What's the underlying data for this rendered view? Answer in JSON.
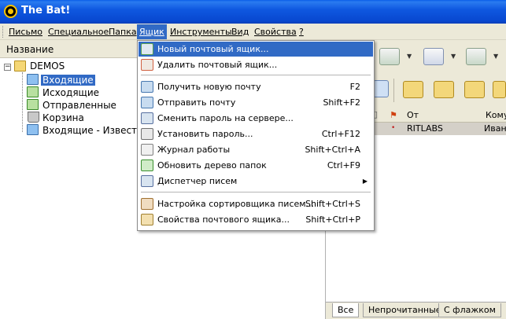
{
  "window": {
    "title": "The Bat!"
  },
  "menubar": {
    "items": [
      {
        "label": "Письмо"
      },
      {
        "label": "Специальное"
      },
      {
        "label": "Папка"
      },
      {
        "label": "Ящик"
      },
      {
        "label": "Инструменты"
      },
      {
        "label": "Вид"
      },
      {
        "label": "Свойства"
      },
      {
        "label": "?"
      }
    ]
  },
  "tree": {
    "header": "Название",
    "root": "DEMOS",
    "folders": [
      {
        "label": "Входящие",
        "icon": "inbox-folder-icon",
        "selected": true
      },
      {
        "label": "Исходящие",
        "icon": "outbox-folder-icon"
      },
      {
        "label": "Отправленные",
        "icon": "sent-folder-icon"
      },
      {
        "label": "Корзина",
        "icon": "trash-icon"
      },
      {
        "label": "Входящие - Известные",
        "icon": "inbox-known-folder-icon"
      }
    ]
  },
  "message_list": {
    "columns": [
      "От",
      "Кому"
    ],
    "rows": [
      {
        "from": "RITLABS",
        "to": "Иван"
      }
    ]
  },
  "tabs": [
    "Все",
    "Непрочитанные",
    "С флажком"
  ],
  "dropdown": {
    "items": [
      {
        "label": "Новый почтовый ящик...",
        "shortcut": "",
        "icon": "new-mailbox-icon",
        "highlight": true
      },
      {
        "label": "Удалить почтовый ящик...",
        "shortcut": "",
        "icon": "delete-mailbox-icon"
      },
      {
        "label": "Получить новую почту",
        "shortcut": "F2",
        "icon": "get-mail-icon"
      },
      {
        "label": "Отправить почту",
        "shortcut": "Shift+F2",
        "icon": "send-mail-icon"
      },
      {
        "label": "Сменить пароль на сервере...",
        "shortcut": "",
        "icon": "change-password-icon"
      },
      {
        "label": "Установить пароль...",
        "shortcut": "Ctrl+F12",
        "icon": "set-password-icon"
      },
      {
        "label": "Журнал работы",
        "shortcut": "Shift+Ctrl+A",
        "icon": "log-icon"
      },
      {
        "label": "Обновить дерево папок",
        "shortcut": "Ctrl+F9",
        "icon": "refresh-tree-icon"
      },
      {
        "label": "Диспетчер писем",
        "shortcut": "",
        "icon": "dispatcher-icon",
        "submenu": true
      },
      {
        "label": "Настройка сортировщика писем...",
        "shortcut": "Shift+Ctrl+S",
        "icon": "sorter-icon"
      },
      {
        "label": "Свойства почтового ящика...",
        "shortcut": "Shift+Ctrl+P",
        "icon": "mailbox-properties-icon"
      }
    ]
  },
  "colors": {
    "titlebar": "#0a58e0",
    "highlight": "#316ac5",
    "chrome": "#ece9d8"
  }
}
